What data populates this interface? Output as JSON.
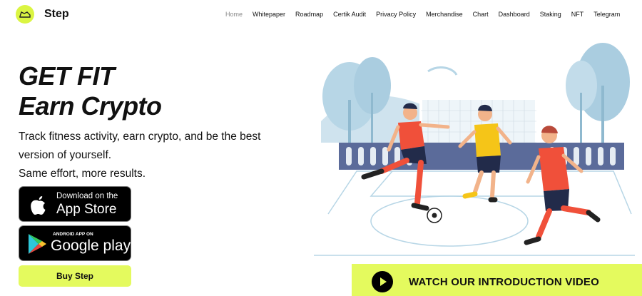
{
  "nav": {
    "brand": "Step",
    "items": [
      {
        "label": "Home",
        "active": true
      },
      {
        "label": "Whitepaper"
      },
      {
        "label": "Roadmap"
      },
      {
        "label": "Certik Audit"
      },
      {
        "label": "Privacy Policy"
      },
      {
        "label": "Merchandise"
      },
      {
        "label": "Chart"
      },
      {
        "label": "Dashboard"
      },
      {
        "label": "Staking"
      },
      {
        "label": "NFT"
      },
      {
        "label": "Telegram"
      }
    ]
  },
  "hero": {
    "title_line1": "GET FIT",
    "title_line2": "Earn Crypto",
    "sub_line1": "Track fitness activity, earn crypto, and be the best",
    "sub_line2": "version of yourself.",
    "sub_line3": "Same effort, more results."
  },
  "badges": {
    "appstore_small": "Download on the",
    "appstore_big": "App Store",
    "google_small": "ANDROID APP ON",
    "google_big": "Google play"
  },
  "buy_label": "Buy Step",
  "video_label": "WATCH OUR INTRODUCTION VIDEO",
  "colors": {
    "accent": "#e4fa5e",
    "shirt_red": "#f0503a",
    "shirt_yellow": "#f5c518",
    "sky_blue": "#b7d6e6"
  }
}
